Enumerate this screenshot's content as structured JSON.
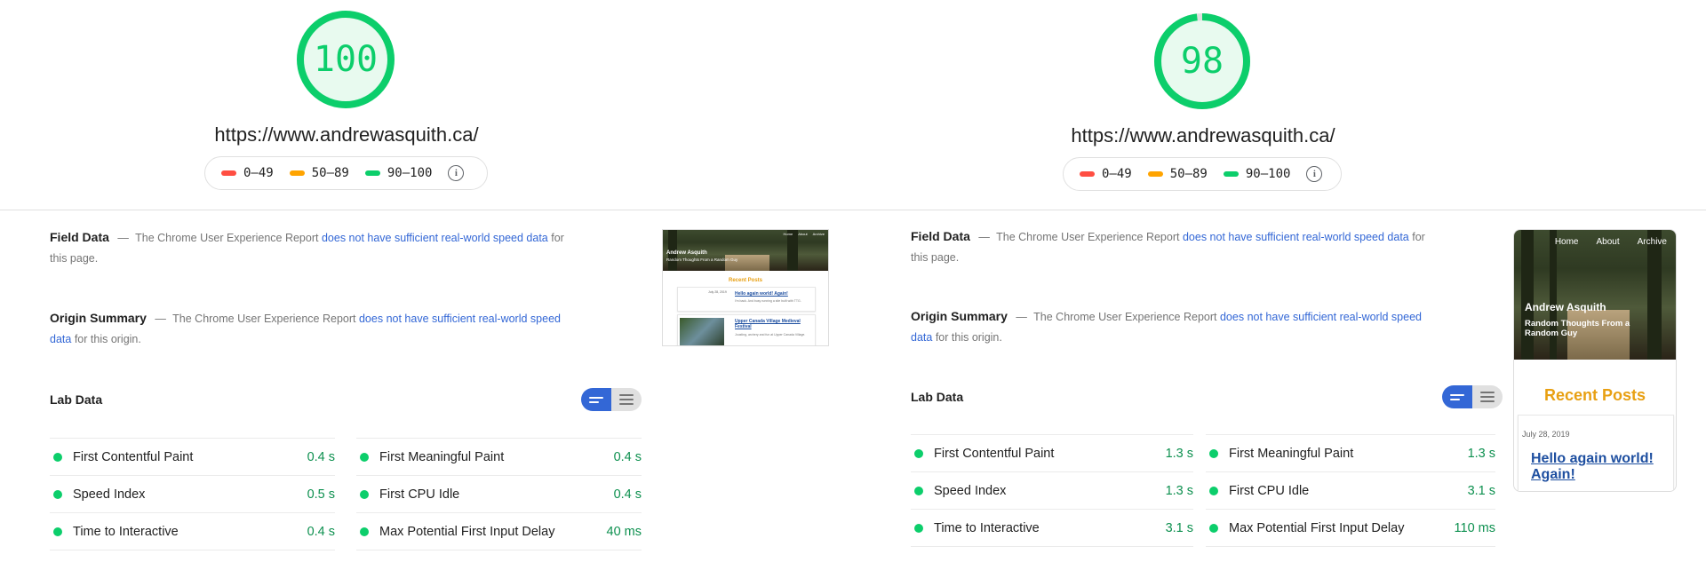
{
  "left": {
    "score": "100",
    "url": "https://www.andrewasquith.ca/",
    "legend": {
      "fail": "0–49",
      "average": "50–89",
      "pass": "90–100"
    },
    "field_data": {
      "title": "Field Data",
      "dash": "—",
      "prefix": "The Chrome User Experience Report",
      "link": "does not have sufficient real-world speed data",
      "suffix": "for this page."
    },
    "origin_summary": {
      "title": "Origin Summary",
      "dash": "—",
      "prefix": "The Chrome User Experience Report",
      "link": "does not have sufficient real-world speed data",
      "suffix": "for this origin."
    },
    "lab_data": {
      "title": "Lab Data"
    },
    "metrics_left": [
      {
        "name": "First Contentful Paint",
        "value": "0.4 s"
      },
      {
        "name": "Speed Index",
        "value": "0.5 s"
      },
      {
        "name": "Time to Interactive",
        "value": "0.4 s"
      }
    ],
    "metrics_right": [
      {
        "name": "First Meaningful Paint",
        "value": "0.4 s"
      },
      {
        "name": "First CPU Idle",
        "value": "0.4 s"
      },
      {
        "name": "Max Potential First Input Delay",
        "value": "40 ms"
      }
    ],
    "thumbnail": {
      "site_title": "Andrew Asquith",
      "tagline": "Random Thoughts From a Random Guy",
      "nav": [
        "Home",
        "About",
        "Archive"
      ],
      "recent_posts": "Recent Posts",
      "post1_date": "July 28, 2019",
      "post1_title": "Hello again world! Again!",
      "post1_excerpt": "I'm back. And busy running a site built with TTG.",
      "post2_title": "Upper Canada Village Medieval Festival",
      "post2_excerpt": "Jousting, archery and fun at Upper Canada Village."
    }
  },
  "right": {
    "score": "98",
    "url": "https://www.andrewasquith.ca/",
    "legend": {
      "fail": "0–49",
      "average": "50–89",
      "pass": "90–100"
    },
    "field_data": {
      "title": "Field Data",
      "dash": "—",
      "prefix": "The Chrome User Experience Report",
      "link": "does not have sufficient real-world speed data",
      "suffix": "for this page."
    },
    "origin_summary": {
      "title": "Origin Summary",
      "dash": "—",
      "prefix": "The Chrome User Experience Report",
      "link": "does not have sufficient real-world speed data",
      "suffix": "for this origin."
    },
    "lab_data": {
      "title": "Lab Data"
    },
    "metrics_left": [
      {
        "name": "First Contentful Paint",
        "value": "1.3 s"
      },
      {
        "name": "Speed Index",
        "value": "1.3 s"
      },
      {
        "name": "Time to Interactive",
        "value": "3.1 s"
      }
    ],
    "metrics_right": [
      {
        "name": "First Meaningful Paint",
        "value": "1.3 s"
      },
      {
        "name": "First CPU Idle",
        "value": "3.1 s"
      },
      {
        "name": "Max Potential First Input Delay",
        "value": "110 ms"
      }
    ],
    "thumbnail": {
      "site_title": "Andrew Asquith",
      "tagline": "Random Thoughts From a Random Guy",
      "nav": [
        "Home",
        "About",
        "Archive"
      ],
      "recent_posts": "Recent Posts",
      "post1_date": "July 28, 2019",
      "post1_title": "Hello again world! Again!"
    }
  },
  "colors": {
    "pass": "#0cce6b",
    "average": "#ffa400",
    "fail": "#ff4e42",
    "link": "#3367d6",
    "toggle_active": "#3367d6"
  }
}
